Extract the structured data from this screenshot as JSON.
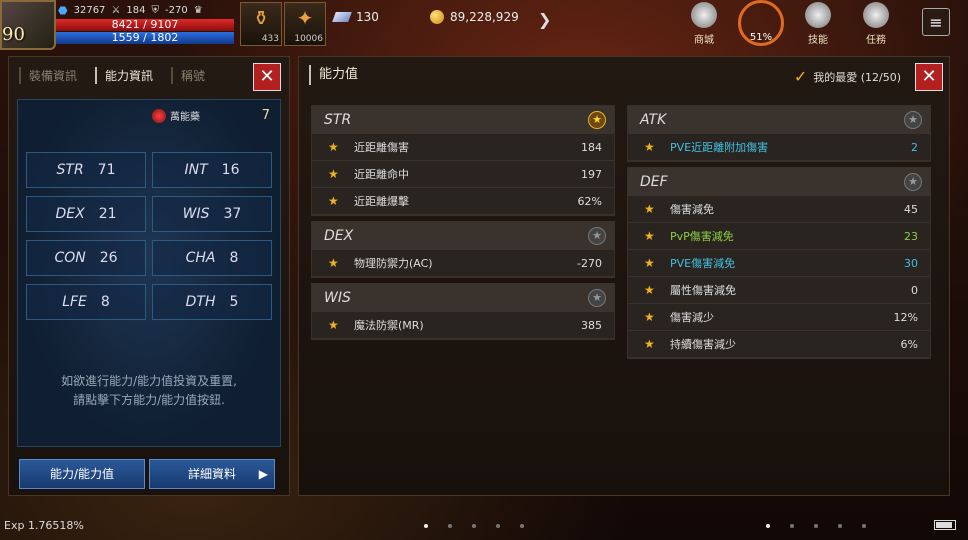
{
  "hud": {
    "level": "90",
    "combat_power": "32767",
    "attack": "184",
    "defense": "-270",
    "hp": "8421 / 9107",
    "mp": "1559 / 1802",
    "slot1_count": "433",
    "slot2_count": "10006",
    "gems": "130",
    "gold": "89,228,929",
    "menu": [
      {
        "label": "商城"
      },
      {
        "label": "51%"
      },
      {
        "label": "技能"
      },
      {
        "label": "任務"
      }
    ]
  },
  "left_panel": {
    "tabs": [
      "裝備資訊",
      "能力資訊",
      "稱號"
    ],
    "potion_label": "萬能藥",
    "potion_count": "7",
    "stats": [
      {
        "name": "STR",
        "value": "71"
      },
      {
        "name": "INT",
        "value": "16"
      },
      {
        "name": "DEX",
        "value": "21"
      },
      {
        "name": "WIS",
        "value": "37"
      },
      {
        "name": "CON",
        "value": "26"
      },
      {
        "name": "CHA",
        "value": "8"
      },
      {
        "name": "LFE",
        "value": "8"
      },
      {
        "name": "DTH",
        "value": "5"
      }
    ],
    "hint_line1": "如欲進行能力/能力值投資及重置,",
    "hint_line2": "請點擊下方能力/能力值按鈕.",
    "btn_ability": "能力/能力值",
    "btn_detail": "詳細資料"
  },
  "right_panel": {
    "title": "能力值",
    "favorite": "我的最愛 (12/50)",
    "sections": {
      "str": {
        "head": "STR",
        "rows": [
          {
            "name": "近距離傷害",
            "value": "184"
          },
          {
            "name": "近距離命中",
            "value": "197"
          },
          {
            "name": "近距離爆擊",
            "value": "62%"
          }
        ]
      },
      "dex": {
        "head": "DEX",
        "rows": [
          {
            "name": "物理防禦力(AC)",
            "value": "-270"
          }
        ]
      },
      "wis": {
        "head": "WIS",
        "rows": [
          {
            "name": "魔法防禦(MR)",
            "value": "385"
          }
        ]
      },
      "atk": {
        "head": "ATK",
        "rows": [
          {
            "name": "PVE近距離附加傷害",
            "value": "2"
          }
        ]
      },
      "def": {
        "head": "DEF",
        "rows": [
          {
            "name": "傷害減免",
            "value": "45"
          },
          {
            "name": "PvP傷害減免",
            "value": "23"
          },
          {
            "name": "PVE傷害減免",
            "value": "30"
          },
          {
            "name": "屬性傷害減免",
            "value": "0"
          },
          {
            "name": "傷害減少",
            "value": "12%"
          },
          {
            "name": "持續傷害減少",
            "value": "6%"
          }
        ]
      }
    }
  },
  "footer": {
    "exp": "Exp 1.76518%"
  }
}
